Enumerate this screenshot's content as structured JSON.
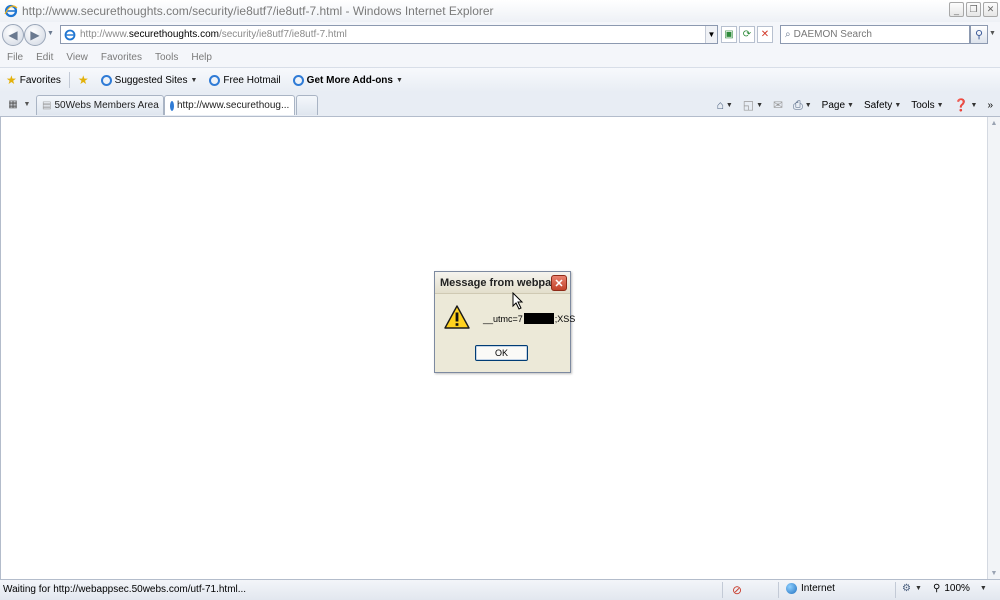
{
  "window": {
    "title": "http://www.securethoughts.com/security/ie8utf7/ie8utf-7.html - Windows Internet Explorer"
  },
  "address": {
    "url_prefix": "http://www.",
    "url_domain": "securethoughts.com",
    "url_path": "/security/ie8utf7/ie8utf-7.html"
  },
  "search": {
    "placeholder": "DAEMON Search"
  },
  "menu": [
    "File",
    "Edit",
    "View",
    "Favorites",
    "Tools",
    "Help"
  ],
  "favorites_bar": {
    "favorites_label": "Favorites",
    "suggested_sites": "Suggested Sites",
    "free_hotmail": "Free Hotmail",
    "get_addons": "Get More Add-ons"
  },
  "tabs": [
    {
      "label": "50Webs Members Area",
      "active": false
    },
    {
      "label": "http://www.securethoug...",
      "active": true
    }
  ],
  "commands": {
    "page": "Page",
    "safety": "Safety",
    "tools": "Tools"
  },
  "dialog": {
    "title": "Message from webpage",
    "message_prefix": "__utmc=7",
    "message_suffix": ";XSS",
    "ok_label": "OK"
  },
  "status": {
    "text": "Waiting for http://webappsec.50webs.com/utf-71.html...",
    "zone": "Internet",
    "zoom": "100%"
  },
  "icons": {
    "browser": "ie-icon",
    "warning": "warning-icon"
  }
}
